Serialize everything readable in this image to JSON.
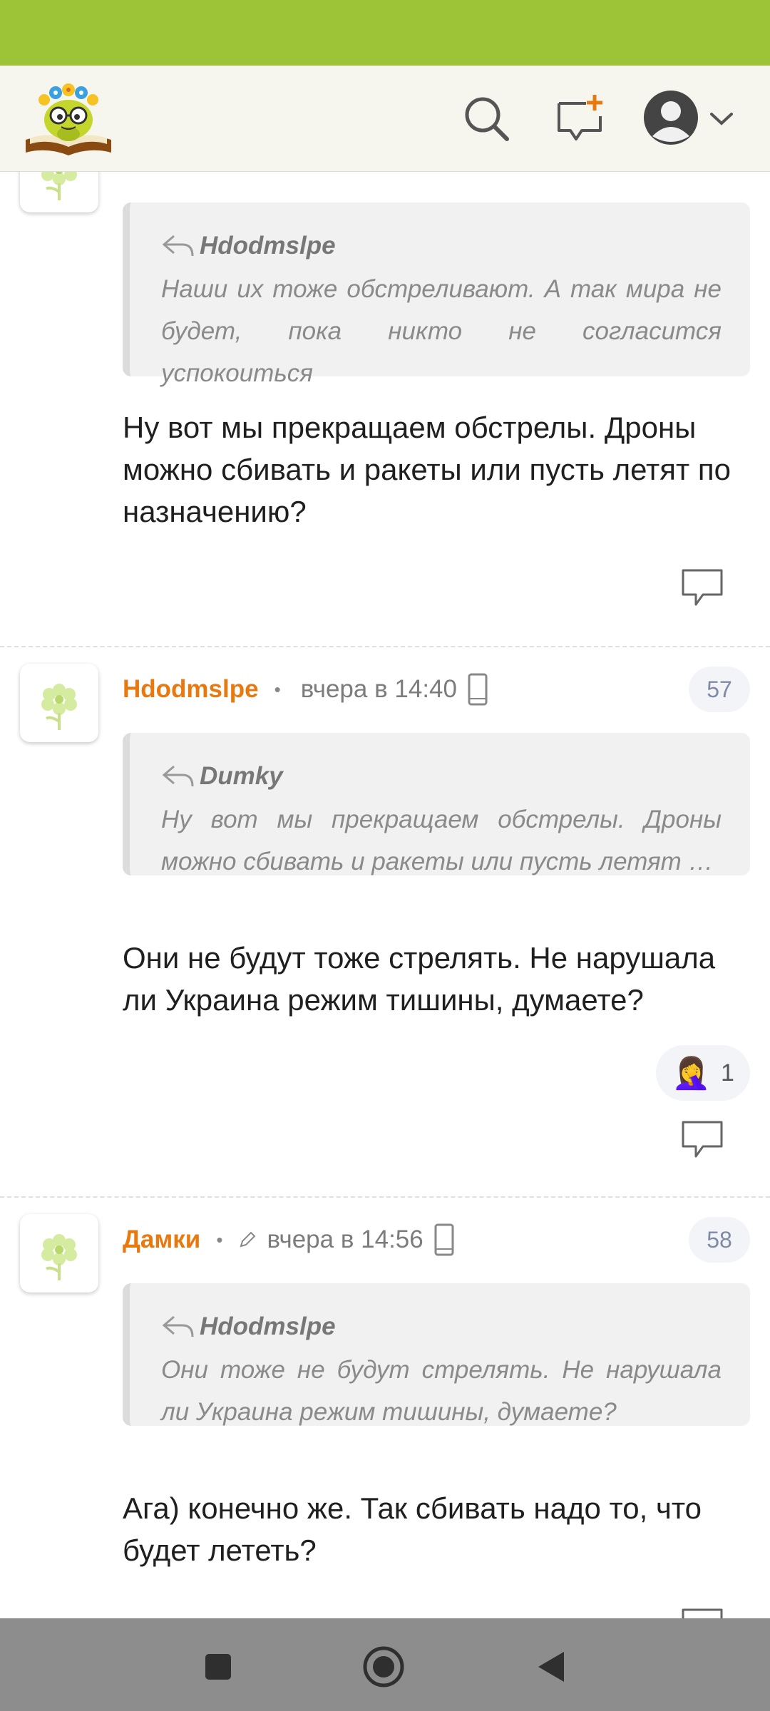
{
  "colors": {
    "status_bar": "#9dc437",
    "author": "#e8790f",
    "nav_bar": "#8d8d8d"
  },
  "header": {
    "logo_icon": "bookworm-logo",
    "search_icon": "search-icon",
    "new_post_icon": "new-message-plus-icon",
    "profile_icon": "user-avatar-icon",
    "dropdown_icon": "chevron-down-icon"
  },
  "comments": [
    {
      "quote": {
        "author": "Hdodmslpe",
        "text": "Наши их тоже обстреливают. А так мира не будет, пока никто не согласится успокоиться"
      },
      "text": "Ну вот мы прекращаем обстрелы. Дроны можно сбивать и ракеты или пусть летят по назначению?"
    },
    {
      "author": "Hdodmslpe",
      "time": "вчера в 14:40",
      "number": "57",
      "quote": {
        "author": "Dumky",
        "text": "Ну вот мы прекращаем обстрелы. Дроны можно сбивать и ракеты или пусть летят …"
      },
      "text": "Они не будут тоже стрелять. Не нарушала ли Украина режим тишины, думаете?",
      "reaction": {
        "emoji": "🤦‍♀️",
        "count": "1"
      }
    },
    {
      "author": "Дамки",
      "time": "вчера в 14:56",
      "number": "58",
      "quote": {
        "author": "Hdodmslpe",
        "text": "Они тоже не будут стрелять. Не нарушала ли Украина режим тишины, думаете?"
      },
      "text": "Ага) конечно же. Так сбивать надо то, что будет лететь?"
    }
  ],
  "separator": "•",
  "nav": {
    "recents_icon": "square-icon",
    "home_icon": "circle-home-icon",
    "back_icon": "triangle-back-icon"
  }
}
